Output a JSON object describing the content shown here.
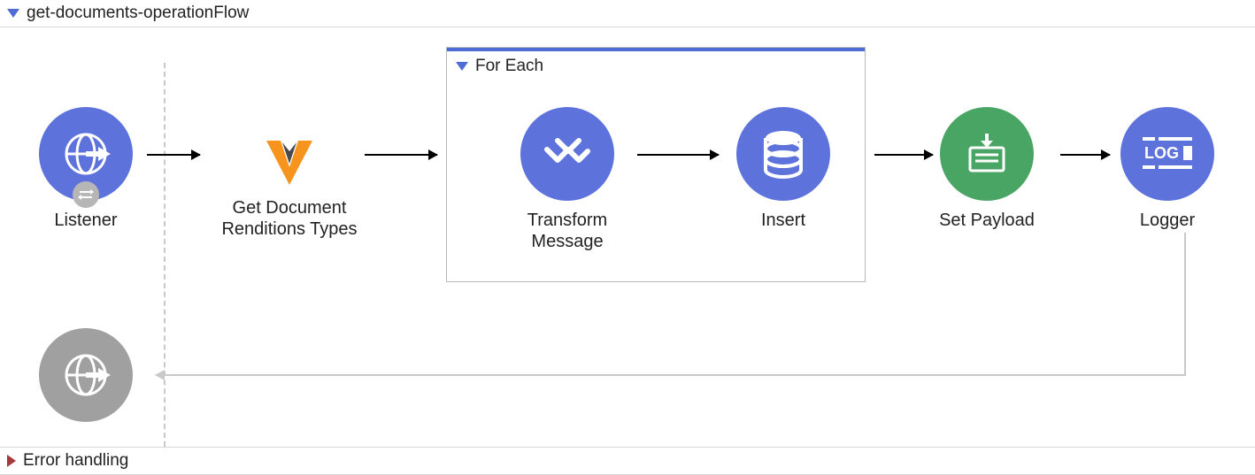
{
  "flow": {
    "title": "get-documents-operationFlow"
  },
  "scope": {
    "title": "For Each"
  },
  "nodes": {
    "listener": {
      "label": "Listener"
    },
    "veeva": {
      "label": "Get Document Renditions Types"
    },
    "transform": {
      "label": "Transform Message"
    },
    "insert": {
      "label": "Insert"
    },
    "setPayload": {
      "label": "Set Payload"
    },
    "logger": {
      "label": "Logger"
    }
  },
  "errorSection": {
    "title": "Error handling"
  }
}
